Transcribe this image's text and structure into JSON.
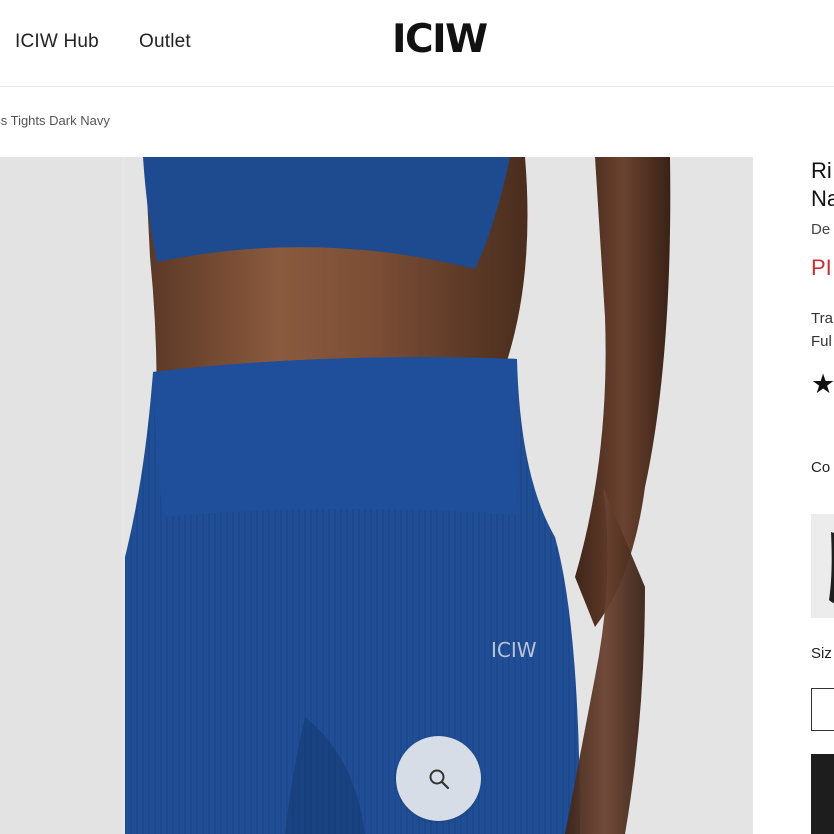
{
  "header": {
    "nav": [
      {
        "label": "ICIW Hub"
      },
      {
        "label": "Outlet"
      }
    ],
    "logo": "ICIW"
  },
  "breadcrumb": {
    "current": "ess Tights Dark Navy"
  },
  "gallery": {
    "product_logo": "ICIW",
    "zoom_icon": "search-icon"
  },
  "product": {
    "title_line1": "Ri",
    "title_line2": "Na",
    "subtitle": "De",
    "price": "PI",
    "desc_line1": "Tra",
    "desc_line2": "Ful",
    "rating_icon": "star-icon",
    "color_label": "Co",
    "size_label": "Siz"
  },
  "colors": {
    "price": "#c8302f",
    "garment": "#1f4f99",
    "zoom_button": "#d6dde6",
    "cart_button": "#1d1d1d"
  }
}
